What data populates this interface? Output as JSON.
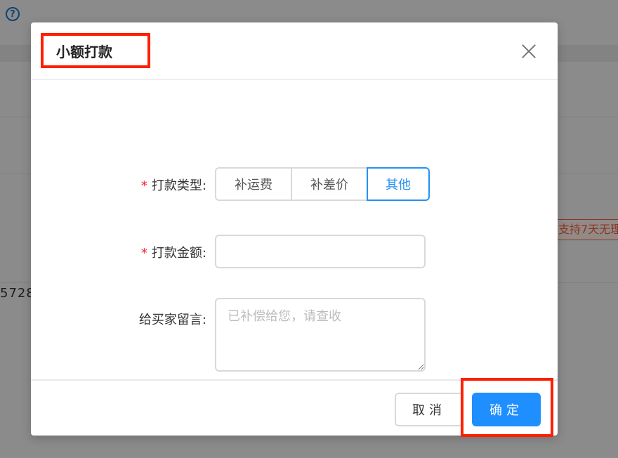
{
  "background": {
    "help_icon": "?",
    "partial_number": "5728",
    "partial_badge": "支持7天无理"
  },
  "modal": {
    "title": "小额打款",
    "close_icon": "close-icon",
    "fields": {
      "type": {
        "label": "打款类型:",
        "required_mark": "*",
        "options": [
          "补运费",
          "补差价",
          "其他"
        ],
        "selected": "其他"
      },
      "amount": {
        "label": "打款金额:",
        "required_mark": "*",
        "value": "",
        "placeholder": ""
      },
      "message": {
        "label": "给买家留言:",
        "value": "",
        "placeholder": "已补偿给您，请查收"
      }
    },
    "footer": {
      "cancel_label": "取消",
      "confirm_label": "确定"
    }
  },
  "colors": {
    "accent": "#1f8fff",
    "highlight": "#ff1f00",
    "required": "#f5222d"
  }
}
